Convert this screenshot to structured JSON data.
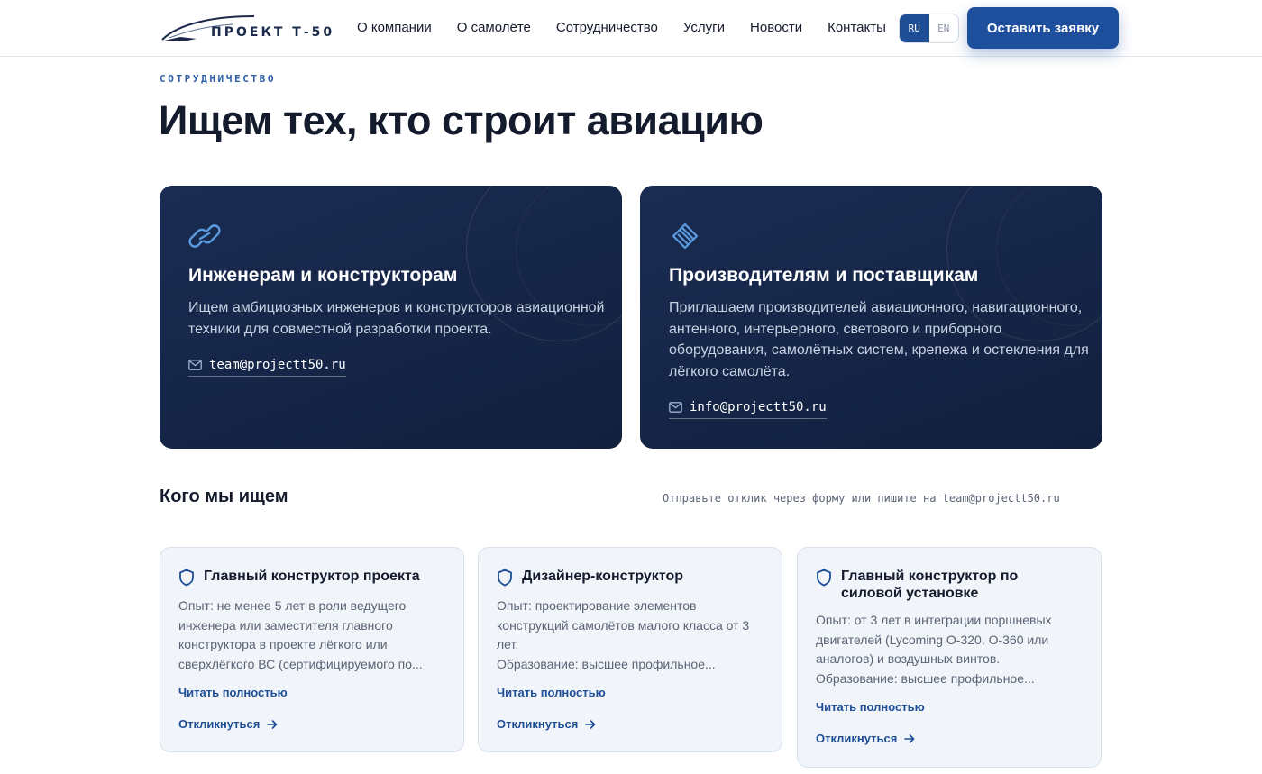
{
  "header": {
    "logo_text": "ПРОЕКТ Т-50",
    "nav": [
      "О компании",
      "О самолёте",
      "Сотрудничество",
      "Услуги",
      "Новости",
      "Контакты"
    ],
    "lang": {
      "ru": "RU",
      "en": "EN",
      "active": "RU"
    },
    "cta_label": "Оставить заявку"
  },
  "section": {
    "eyebrow": "СОТРУДНИЧЕСТВО",
    "title": "Ищем тех, кто строит авиацию"
  },
  "partners": [
    {
      "icon": "link-icon",
      "title": "Инженерам и конструкторам",
      "lines": [
        "Ищем амбициозных инженеров и конструкторов авиационной",
        "техники для совместной разработки проекта."
      ],
      "email": "team@projectt50.ru"
    },
    {
      "icon": "diamond-layers-icon",
      "title": "Производителям и поставщикам",
      "lines": [
        "Приглашаем производителей авиационного, навигационного,",
        "антенного, интерьерного, светового и приборного",
        "оборудования, самолётных систем, крепежа и остекления для",
        "лёгкого самолёта."
      ],
      "email": "info@projectt50.ru"
    }
  ],
  "vacancies": {
    "title": "Кого мы ищем",
    "note": "Отправьте отклик через форму или пишите на team@projectt50.ru",
    "items": [
      {
        "title": "Главный конструктор проекта",
        "lines": [
          "Опыт: не менее 5 лет в роли ведущего",
          "инженера или заместителя главного",
          "конструктора в проекте лёгкого или",
          "сверхлёгкого ВС (сертифицируемого по..."
        ],
        "read_more": "Читать полностью",
        "apply": "Откликнуться"
      },
      {
        "title": "Дизайнер-конструктор",
        "lines": [
          "Опыт: проектирование элементов",
          "конструкций самолётов малого класса от 3",
          "лет.",
          "Образование: высшее профильное..."
        ],
        "read_more": "Читать полностью",
        "apply": "Откликнуться"
      },
      {
        "title": "Главный конструктор по силовой установке",
        "lines": [
          "Опыт: от 3 лет в интеграции поршневых",
          "двигателей (Lycoming O-320, O-360 или",
          "аналогов) и воздушных винтов.",
          "Образование: высшее профильное..."
        ],
        "read_more": "Читать полностью",
        "apply": "Откликнуться"
      }
    ]
  },
  "colors": {
    "brand": "#1d4f9c",
    "dark_card": "#14223f",
    "job_card_bg": "#f1f5fa"
  }
}
